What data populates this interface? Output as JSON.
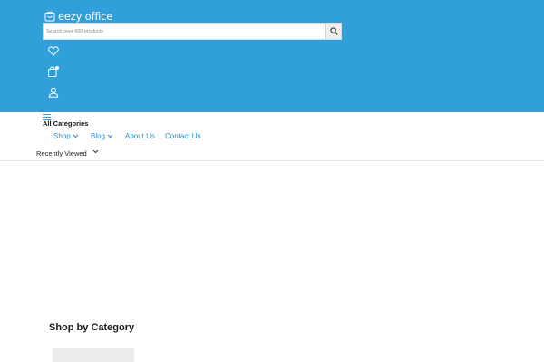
{
  "header": {
    "bg_color": "#319fd9",
    "logo": {
      "text": "eezy office",
      "icon": "cart-bag-logo-icon"
    }
  },
  "search": {
    "placeholder": "Search over 900 products",
    "value": "",
    "button_icon": "search-icon"
  },
  "header_icons": [
    {
      "name": "wishlist-heart-icon"
    },
    {
      "name": "cart-bag-icon"
    },
    {
      "name": "account-user-icon"
    }
  ],
  "menu": {
    "toggle_icon": "hamburger-icon",
    "all_categories_label": "All Categories",
    "items": [
      {
        "label": "Shop",
        "has_dropdown": true
      },
      {
        "label": "Blog",
        "has_dropdown": true
      },
      {
        "label": "About Us",
        "has_dropdown": false
      },
      {
        "label": "Contact Us",
        "has_dropdown": false
      }
    ]
  },
  "recently_viewed": {
    "label": "Recently Viewed",
    "icon": "chevron-down-icon"
  },
  "shop_by_category": {
    "title": "Shop by Category"
  },
  "colors": {
    "accent": "#319fd9",
    "link": "#2b8ac4"
  }
}
